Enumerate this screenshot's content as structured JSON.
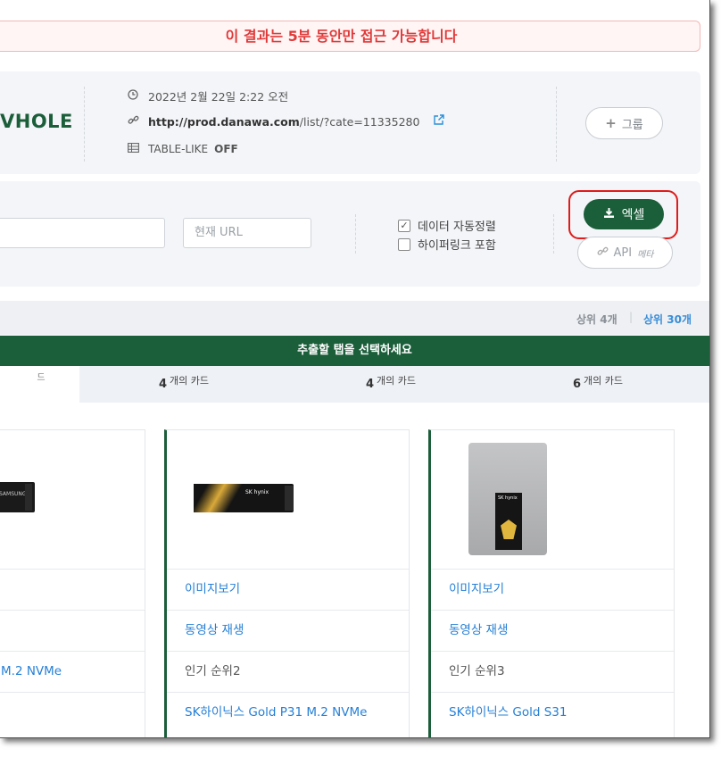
{
  "banner": {
    "text": "이 결과는 5분 동안만 접근 가능합니다"
  },
  "header": {
    "title_fragment": "VHOLE",
    "timestamp": "2022년 2월 22일 2:22 오전",
    "url_host": "http://prod.danawa.com",
    "url_path": "/list/?cate=11335280",
    "table_like_label": "TABLE-LIKE",
    "table_like_value": "OFF",
    "group_button": "그룹"
  },
  "controls": {
    "current_url_placeholder": "현재 URL",
    "auto_sort_label": "데이터 자동정렬",
    "auto_sort_checked": true,
    "hyperlink_label": "하이퍼링크 포함",
    "hyperlink_checked": false,
    "excel_button": "엑셀",
    "api_button": "API",
    "api_meta": "메타"
  },
  "pager": {
    "top4": "상위 4개",
    "separator": "|",
    "top30": "상위 30개"
  },
  "tab_bar": {
    "title": "추출할 탭을 선택하세요"
  },
  "tabs": [
    {
      "count": "",
      "label": "드"
    },
    {
      "count": "4",
      "label": "개의 카드"
    },
    {
      "count": "4",
      "label": "개의 카드"
    },
    {
      "count": "6",
      "label": "개의 카드"
    }
  ],
  "cards": [
    {
      "image": "samsung-ssd",
      "row1": "",
      "row2": "",
      "row3": "M.2 NVMe",
      "row4": ""
    },
    {
      "image": "sk-hynix-m2",
      "row1": "이미지보기",
      "row2": "동영상 재생",
      "row3": "인기 순위2",
      "row4": "SK하이닉스 Gold P31 M.2 NVMe"
    },
    {
      "image": "sk-hynix-sata",
      "row1": "이미지보기",
      "row2": "동영상 재생",
      "row3": "인기 순위3",
      "row4": "SK하이닉스 Gold S31"
    }
  ],
  "colors": {
    "brand_green": "#1b5e3a",
    "alert_red": "#e03a3a",
    "link_blue": "#2680d6"
  }
}
